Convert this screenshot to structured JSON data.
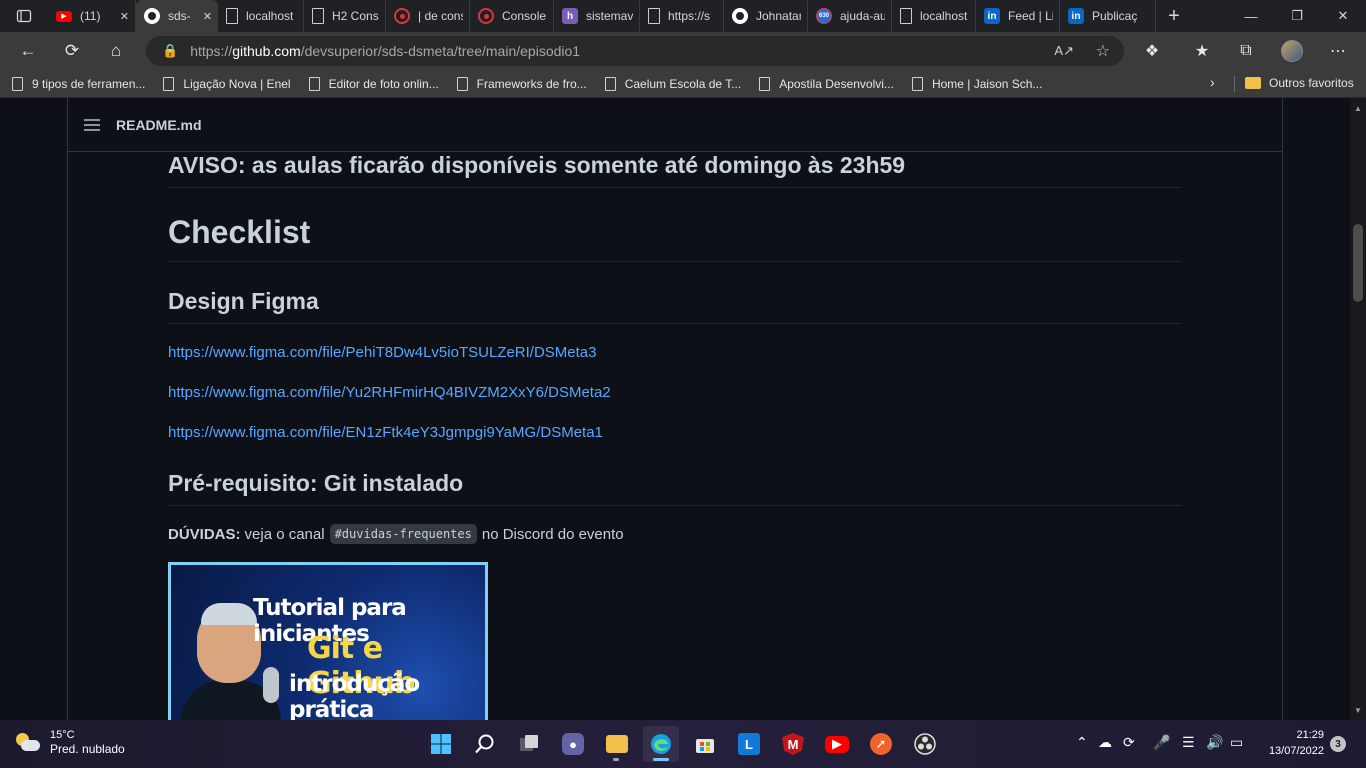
{
  "browser": {
    "tabs": [
      {
        "title": "(11)",
        "favicon": "youtube-icon",
        "color": "#ff0000"
      },
      {
        "title": "sds-",
        "favicon": "github-icon",
        "color": "#ffffff",
        "active": true
      },
      {
        "title": "localhost",
        "favicon": "page-icon",
        "color": "#cccccc"
      },
      {
        "title": "H2 Cons",
        "favicon": "page-icon",
        "color": "#cccccc"
      },
      {
        "title": "| de cons",
        "favicon": "site-icon",
        "color": "#d9363e"
      },
      {
        "title": "Console",
        "favicon": "site-icon",
        "color": "#d9363e"
      },
      {
        "title": "sistemav",
        "favicon": "heroku-icon",
        "color": "#7b5cb8"
      },
      {
        "title": "https://s",
        "favicon": "page-icon",
        "color": "#cccccc"
      },
      {
        "title": "Johnatan",
        "favicon": "github-icon",
        "color": "#ffffff"
      },
      {
        "title": "ajuda-au",
        "favicon": "badge-630-icon",
        "color": "#2b6cd4"
      },
      {
        "title": "localhost",
        "favicon": "page-icon",
        "color": "#cccccc"
      },
      {
        "title": "Feed | Lin",
        "favicon": "linkedin-icon",
        "color": "#0a66c2"
      },
      {
        "title": "Publicaç",
        "favicon": "linkedin-icon",
        "color": "#0a66c2"
      }
    ],
    "badge_630": "630",
    "address": {
      "prefix": "https://",
      "domain": "github.com",
      "path": "/devsuperior/sds-dsmeta/tree/main/episodio1"
    },
    "favorites": [
      "9 tipos de ferramen...",
      "Ligação Nova | Enel",
      "Editor de foto onlin...",
      "Frameworks de fro...",
      "Caelum Escola de T...",
      "Apostila Desenvolvi...",
      "Home | Jaison Sch..."
    ],
    "other_favorites": "Outros favoritos"
  },
  "readme": {
    "filename": "README.md",
    "aviso": "AVISO: as aulas ficarão disponíveis somente até domingo às 23h59",
    "checklist": "Checklist",
    "design_heading": "Design Figma",
    "links": [
      "https://www.figma.com/file/PehiT8Dw4Lv5ioTSULZeRI/DSMeta3",
      "https://www.figma.com/file/Yu2RHFmirHQ4BIVZM2XxY6/DSMeta2",
      "https://www.figma.com/file/EN1zFtk4eY3Jgmpgi9YaMG/DSMeta1"
    ],
    "prereq_heading": "Pré-requisito: Git instalado",
    "duvidas_label": "DÚVIDAS:",
    "duvidas_text_1": "veja o canal",
    "duvidas_code": "#duvidas-frequentes",
    "duvidas_text_2": "no Discord do evento",
    "thumbnail": {
      "line1": "Tutorial para iniciantes",
      "line2": "Git e Github",
      "line3": "introdução prática"
    }
  },
  "taskbar": {
    "temperature": "15°C",
    "condition": "Pred. nublado",
    "time": "21:29",
    "date": "13/07/2022",
    "notifications": "3"
  }
}
